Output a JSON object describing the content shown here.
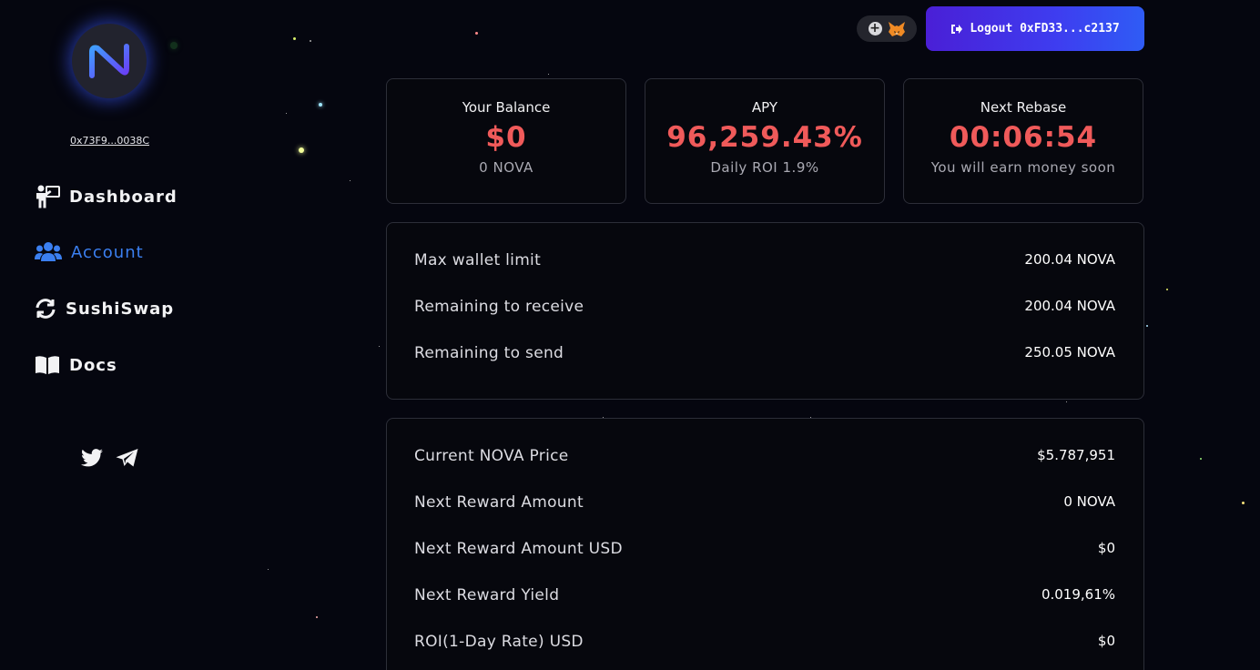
{
  "sidebar": {
    "wallet_address": "0x73F9...0038C",
    "nav": [
      {
        "label": "Dashboard",
        "icon": "presentation-icon"
      },
      {
        "label": "Account",
        "icon": "users-icon",
        "active": true
      },
      {
        "label": "SushiSwap",
        "icon": "sync-icon"
      },
      {
        "label": "Docs",
        "icon": "book-icon"
      }
    ],
    "social": [
      "twitter-icon",
      "telegram-icon"
    ]
  },
  "topbar": {
    "logout_label": "Logout 0xFD33...c2137",
    "wallet_icons": [
      "plus-icon",
      "metamask-fox-icon"
    ]
  },
  "stats": [
    {
      "title": "Your Balance",
      "value": "$0",
      "sub": "0 NOVA"
    },
    {
      "title": "APY",
      "value": "96,259.43%",
      "sub": "Daily ROI 1.9%"
    },
    {
      "title": "Next Rebase",
      "value": "00:06:54",
      "sub": "You will earn money soon"
    }
  ],
  "limits": [
    {
      "label": "Max wallet limit",
      "value": "200.04 NOVA"
    },
    {
      "label": "Remaining to receive",
      "value": "200.04 NOVA"
    },
    {
      "label": "Remaining to send",
      "value": "250.05 NOVA"
    }
  ],
  "rewards": [
    {
      "label": "Current NOVA Price",
      "value": "$5.787,951"
    },
    {
      "label": "Next Reward Amount",
      "value": "0 NOVA"
    },
    {
      "label": "Next Reward Amount USD",
      "value": "$0"
    },
    {
      "label": "Next Reward Yield",
      "value": "0.019,61%"
    },
    {
      "label": "ROI(1-Day Rate) USD",
      "value": "$0"
    }
  ],
  "colors": {
    "background": "#05060f",
    "accent_red": "#f05a5a",
    "active_nav": "#3b7ff0",
    "button_gradient_start": "#4a1fd6",
    "button_gradient_end": "#2f5cf5"
  }
}
